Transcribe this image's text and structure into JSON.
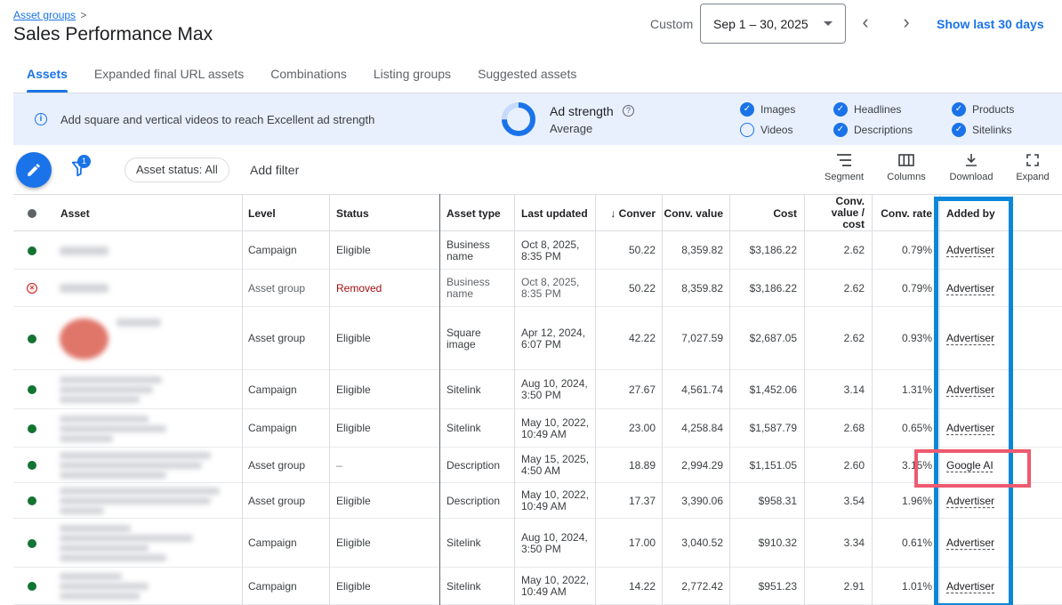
{
  "header": {
    "breadcrumb": "Asset groups",
    "breadcrumb_chevron": ">",
    "title": "Sales Performance Max",
    "date_mode": "Custom",
    "date_range": "Sep 1 – 30, 2025",
    "prev_label": "‹",
    "next_label": "›",
    "show_last": "Show last 30 days"
  },
  "tabs": [
    {
      "label": "Assets",
      "active": true
    },
    {
      "label": "Expanded final URL assets"
    },
    {
      "label": "Combinations"
    },
    {
      "label": "Listing groups"
    },
    {
      "label": "Suggested assets"
    }
  ],
  "banner": {
    "message": "Add square and vertical videos to reach Excellent ad strength",
    "ad_strength_title": "Ad strength",
    "ad_strength_value": "Average",
    "checks": [
      {
        "label": "Images",
        "checked": true
      },
      {
        "label": "Videos",
        "checked": false
      },
      {
        "label": "Headlines",
        "checked": true
      },
      {
        "label": "Descriptions",
        "checked": true
      },
      {
        "label": "Products",
        "checked": true
      },
      {
        "label": "Sitelinks",
        "checked": true
      }
    ]
  },
  "toolbar": {
    "filter_count": "1",
    "status_chip": "Asset status: All",
    "add_filter": "Add filter",
    "segment": "Segment",
    "columns": "Columns",
    "download": "Download",
    "expand": "Expand"
  },
  "table": {
    "headers": {
      "asset": "Asset",
      "level": "Level",
      "status": "Status",
      "asset_type": "Asset type",
      "last_updated": "Last updated",
      "conversions": "↓ Conver",
      "conv_value": "Conv. value",
      "cost": "Cost",
      "conv_value_cost": "Conv. value / cost",
      "conv_rate": "Conv. rate",
      "added_by": "Added by"
    },
    "rows": [
      {
        "level": "Campaign",
        "status": "Eligible",
        "type": "Business name",
        "updated": "Oct 8, 2025, 8:35 PM",
        "conv": "50.22",
        "value": "8,359.82",
        "cost": "$3,186.22",
        "vc": "2.62",
        "rate": "0.79%",
        "added": "Advertiser",
        "removed": false
      },
      {
        "level": "Asset group",
        "status": "Removed",
        "type": "Business name",
        "updated": "Oct 8, 2025, 8:35 PM",
        "conv": "50.22",
        "value": "8,359.82",
        "cost": "$3,186.22",
        "vc": "2.62",
        "rate": "0.79%",
        "added": "Advertiser",
        "removed": true
      },
      {
        "level": "Asset group",
        "status": "Eligible",
        "type": "Square image",
        "updated": "Apr 12, 2024, 6:07 PM",
        "conv": "42.22",
        "value": "7,027.59",
        "cost": "$2,687.05",
        "vc": "2.62",
        "rate": "0.93%",
        "added": "Advertiser",
        "removed": false
      },
      {
        "level": "Campaign",
        "status": "Eligible",
        "type": "Sitelink",
        "updated": "Aug 10, 2024, 3:50 PM",
        "conv": "27.67",
        "value": "4,561.74",
        "cost": "$1,452.06",
        "vc": "3.14",
        "rate": "1.31%",
        "added": "Advertiser",
        "removed": false
      },
      {
        "level": "Campaign",
        "status": "Eligible",
        "type": "Sitelink",
        "updated": "May 10, 2022, 10:49 AM",
        "conv": "23.00",
        "value": "4,258.84",
        "cost": "$1,587.79",
        "vc": "2.68",
        "rate": "0.65%",
        "added": "Advertiser",
        "removed": false
      },
      {
        "level": "Asset group",
        "status": "–",
        "type": "Description",
        "updated": "May 15, 2025, 4:50 AM",
        "conv": "18.89",
        "value": "2,994.29",
        "cost": "$1,151.05",
        "vc": "2.60",
        "rate": "3.15%",
        "added": "Google AI",
        "removed": false
      },
      {
        "level": "Asset group",
        "status": "Eligible",
        "type": "Description",
        "updated": "May 10, 2022, 10:49 AM",
        "conv": "17.37",
        "value": "3,390.06",
        "cost": "$958.31",
        "vc": "3.54",
        "rate": "1.96%",
        "added": "Advertiser",
        "removed": false
      },
      {
        "level": "Campaign",
        "status": "Eligible",
        "type": "Sitelink",
        "updated": "Aug 10, 2024, 3:50 PM",
        "conv": "17.00",
        "value": "3,040.52",
        "cost": "$910.32",
        "vc": "3.34",
        "rate": "0.61%",
        "added": "Advertiser",
        "removed": false
      },
      {
        "level": "Campaign",
        "status": "Eligible",
        "type": "Sitelink",
        "updated": "May 10, 2022, 10:49 AM",
        "conv": "14.22",
        "value": "2,772.42",
        "cost": "$951.23",
        "vc": "2.91",
        "rate": "1.01%",
        "added": "Advertiser",
        "removed": false
      }
    ]
  },
  "colors": {
    "accent": "#1a73e8",
    "eligible": "#137333",
    "removed": "#c5221f",
    "highlight_blue": "#0b87d9",
    "highlight_red": "#ee5a6f"
  }
}
